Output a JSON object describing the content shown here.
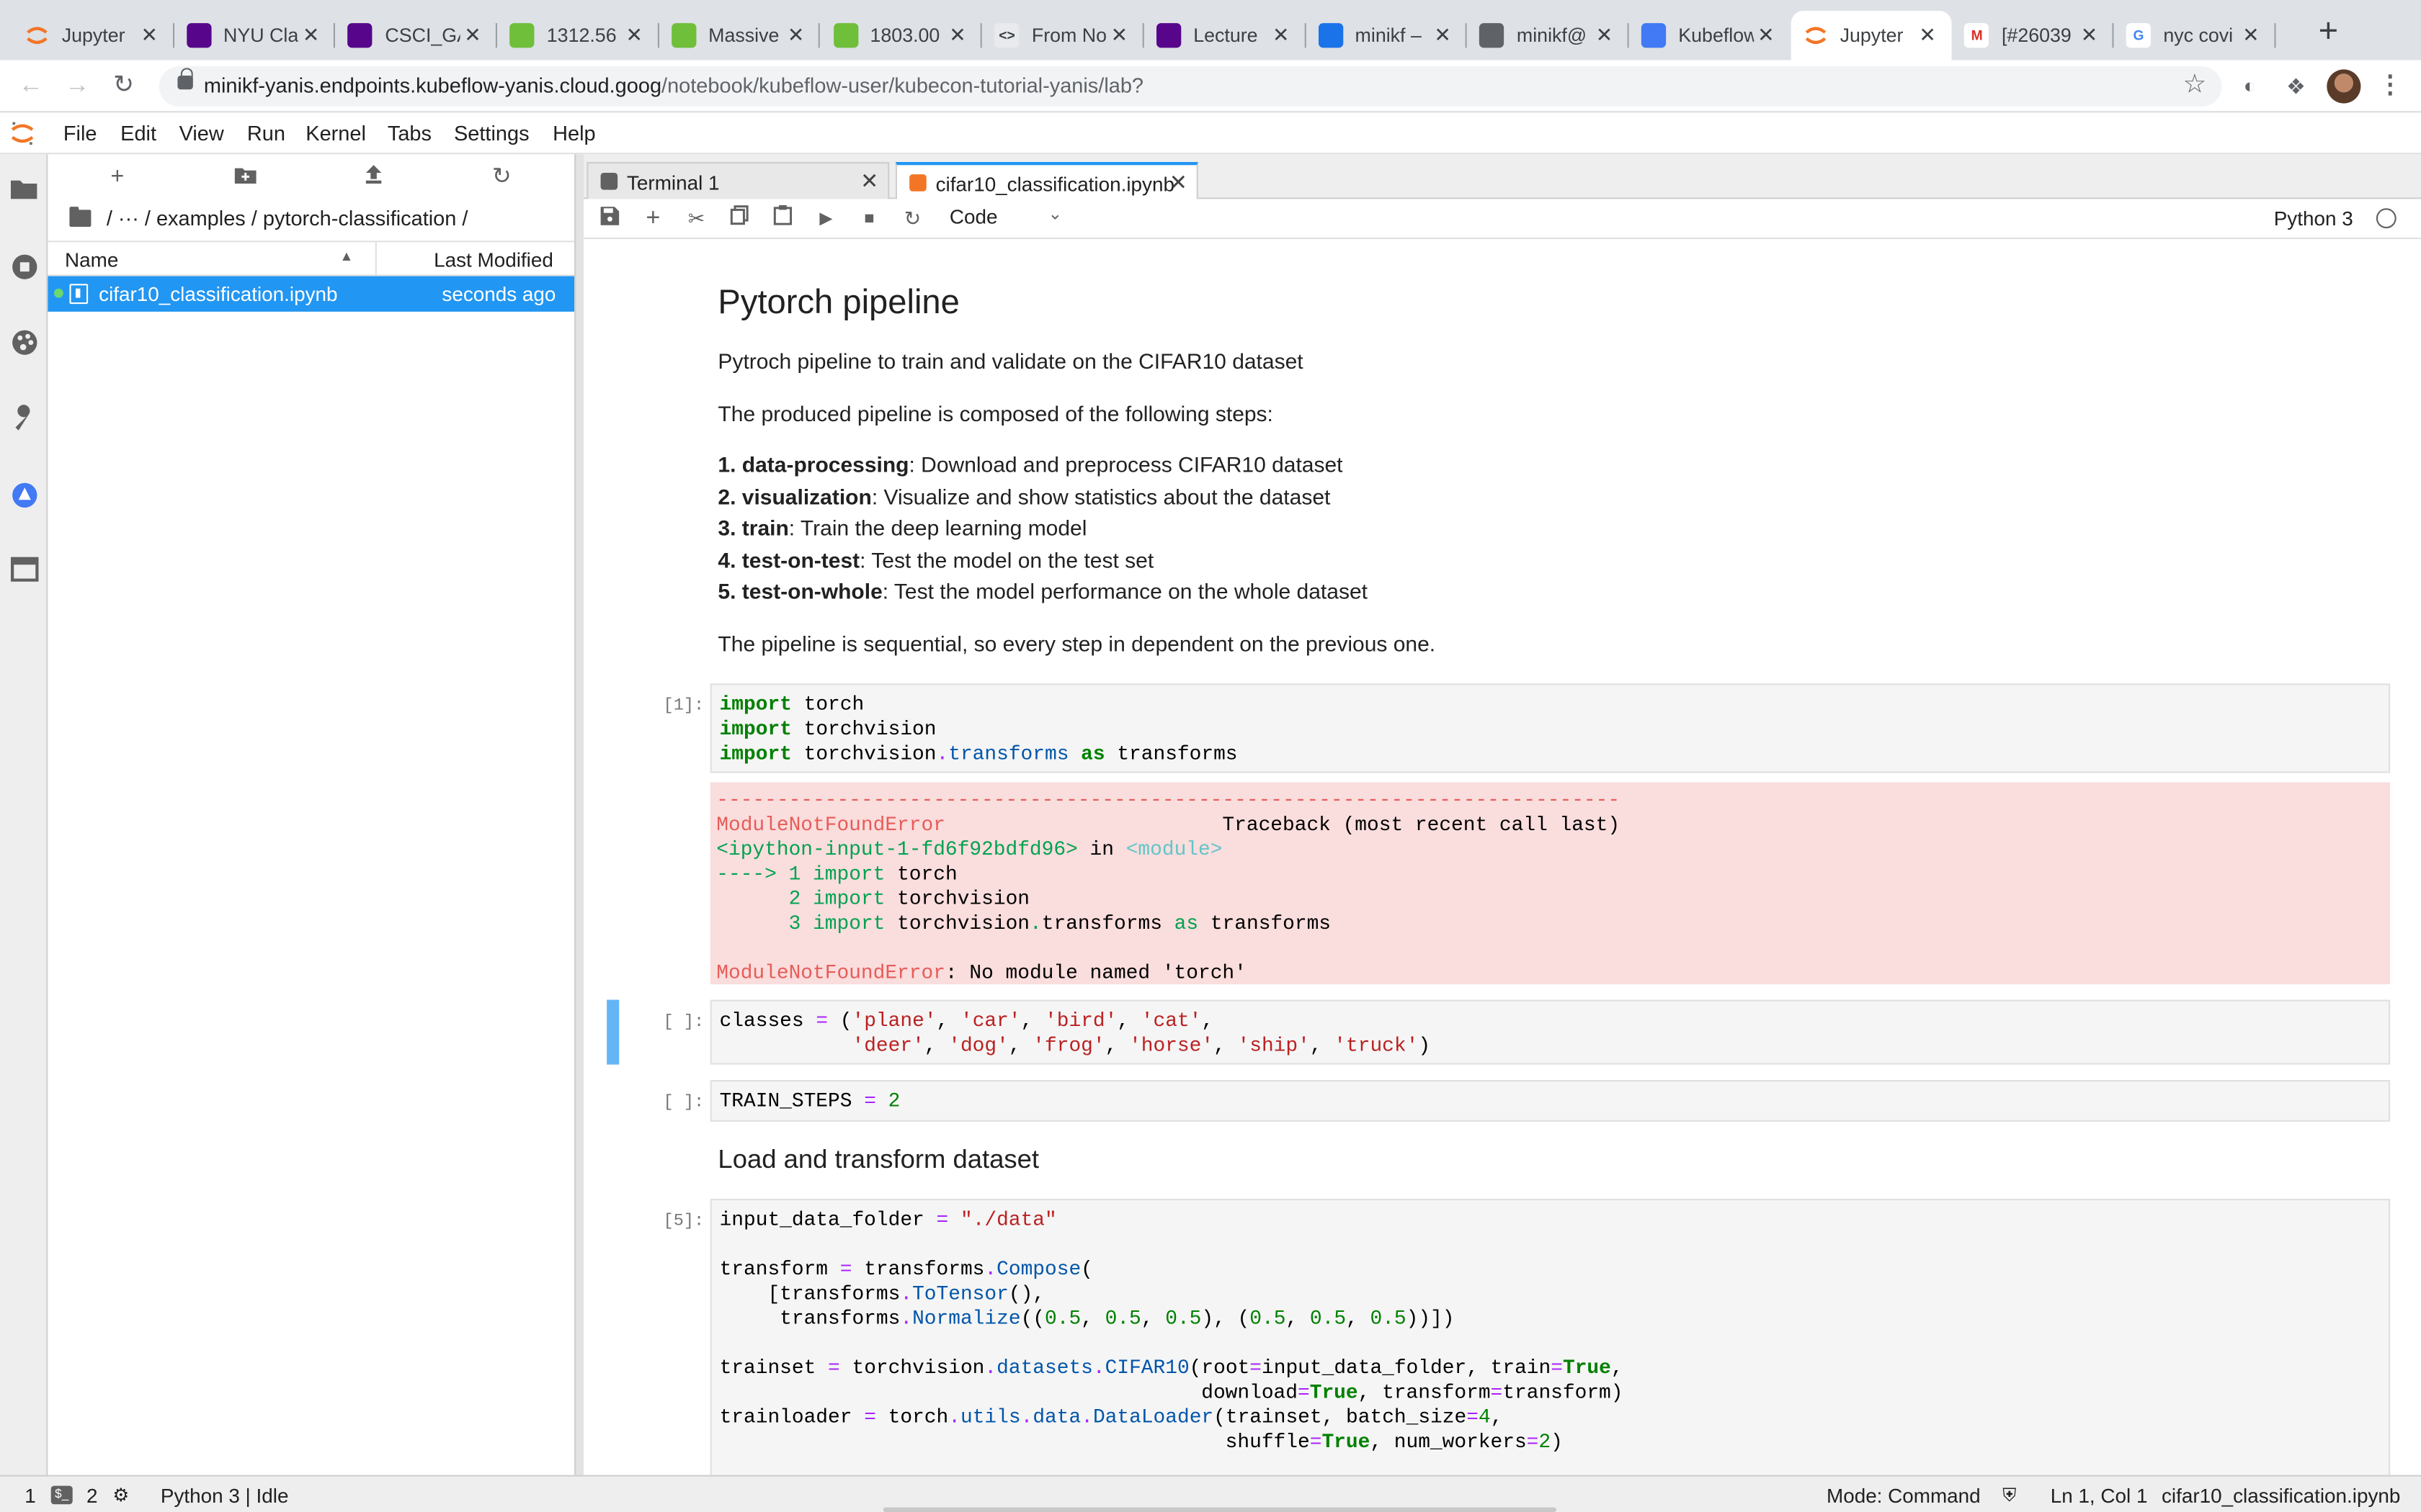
{
  "browser": {
    "tabs": [
      {
        "title": "Jupyter",
        "icon": "jupyter-favicon"
      },
      {
        "title": "NYU Cla",
        "icon": "nyu-favicon"
      },
      {
        "title": "CSCI_GA",
        "icon": "nyu-favicon"
      },
      {
        "title": "1312.56",
        "icon": "smiley-favicon"
      },
      {
        "title": "Massive",
        "icon": "smiley-favicon"
      },
      {
        "title": "1803.00",
        "icon": "smiley-favicon"
      },
      {
        "title": "From No",
        "icon": "code-favicon"
      },
      {
        "title": "Lecture",
        "icon": "nyu-favicon"
      },
      {
        "title": "minikf –",
        "icon": "monitor-favicon"
      },
      {
        "title": "minikf@",
        "icon": "chip-favicon"
      },
      {
        "title": "Kubeflow",
        "icon": "kubeflow-favicon"
      },
      {
        "title": "Jupyter",
        "icon": "jupyter-favicon",
        "active": true
      },
      {
        "title": "[#26039",
        "icon": "gmail-favicon"
      },
      {
        "title": "nyc covi",
        "icon": "google-favicon"
      }
    ],
    "url_host": "minikf-yanis.endpoints.kubeflow-yanis.cloud.goog",
    "url_path": "/notebook/kubeflow-user/kubecon-tutorial-yanis/lab?"
  },
  "menubar": [
    "File",
    "Edit",
    "View",
    "Run",
    "Kernel",
    "Tabs",
    "Settings",
    "Help"
  ],
  "filebrowser": {
    "breadcrumb": "/ ··· / examples / pytorch-classification /",
    "col_name": "Name",
    "col_modified": "Last Modified",
    "files": [
      {
        "name": "cifar10_classification.ipynb",
        "modified": "seconds ago"
      }
    ]
  },
  "dock": {
    "tabs": [
      {
        "label": "Terminal 1"
      },
      {
        "label": "cifar10_classification.ipynb"
      }
    ]
  },
  "nbtoolbar": {
    "cell_type": "Code",
    "kernel": "Python 3"
  },
  "notebook": {
    "title": "Pytorch pipeline",
    "intro": "Pytroch pipeline to train and validate on the CIFAR10 dataset",
    "composed": "The produced pipeline is composed of the following steps:",
    "steps": [
      {
        "num": "1. data-processing",
        "desc": ": Download and preprocess CIFAR10 dataset"
      },
      {
        "num": "2. visualization",
        "desc": ": Visualize and show statistics about the dataset"
      },
      {
        "num": "3. train",
        "desc": ": Train the deep learning model"
      },
      {
        "num": "4. test-on-test",
        "desc": ": Test the model on the test set"
      },
      {
        "num": "5. test-on-whole",
        "desc": ": Test the model performance on the whole dataset"
      }
    ],
    "sequential": "The pipeline is sequential, so every step in dependent on the previous one.",
    "section2": "Load and transform dataset",
    "prompts": [
      "[1]:",
      "[ ]:",
      "[ ]:",
      "[5]:"
    ],
    "error_message": "ModuleNotFoundError: No module named 'torch'"
  },
  "statusbar": {
    "left_count": "1",
    "term_count": "2",
    "kernel": "Python 3 | Idle",
    "mode": "Mode: Command",
    "position": "Ln 1, Col 1",
    "file": "cifar10_classification.ipynb"
  }
}
